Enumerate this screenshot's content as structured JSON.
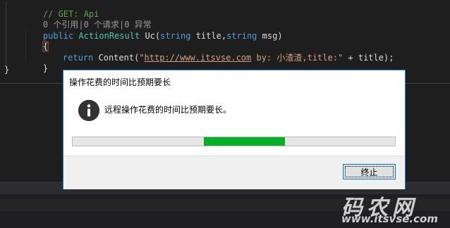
{
  "editor": {
    "line1_comment": "// GET: Api",
    "codelens": "0 个引用|0 个请求|0 异常",
    "sig_public": "public",
    "sig_type": "ActionResult",
    "sig_method": "Uc(",
    "sig_string1": "string",
    "sig_param1": " title,",
    "sig_string2": "string",
    "sig_param2": " msg)",
    "open_brace": "{",
    "ret_kw": "return",
    "ret_call": "Content(",
    "ret_str_quote": "\"",
    "ret_link": "http://www.itsvse.com",
    "ret_str_rest": " by: 小渣渣,title:\"",
    "ret_tail": " + title);",
    "close_brace_inner": "}",
    "close_brace_outer": "}"
  },
  "dialog": {
    "title": "操作花费的时间比预期要长",
    "message": "远程操作花费的时间比预期要长。",
    "icon": "info-icon",
    "stop_label": "终止",
    "progress_color": "#06b025"
  },
  "watermark": {
    "main": "码农网",
    "url": "www.itsvse.com"
  }
}
